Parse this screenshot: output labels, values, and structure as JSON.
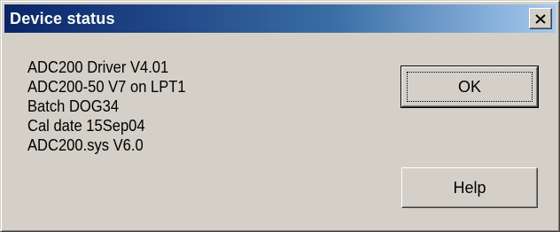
{
  "window": {
    "title": "Device status",
    "close_icon": "close-icon"
  },
  "info_lines": [
    "ADC200 Driver V4.01",
    "ADC200-50 V7 on LPT1",
    "Batch DOG34",
    "Cal date 15Sep04",
    "ADC200.sys V6.0"
  ],
  "buttons": {
    "ok_label": "OK",
    "help_label": "Help"
  },
  "colors": {
    "titlebar_start": "#0a246a",
    "titlebar_end": "#a6caf0",
    "face": "#d4d0c8"
  }
}
